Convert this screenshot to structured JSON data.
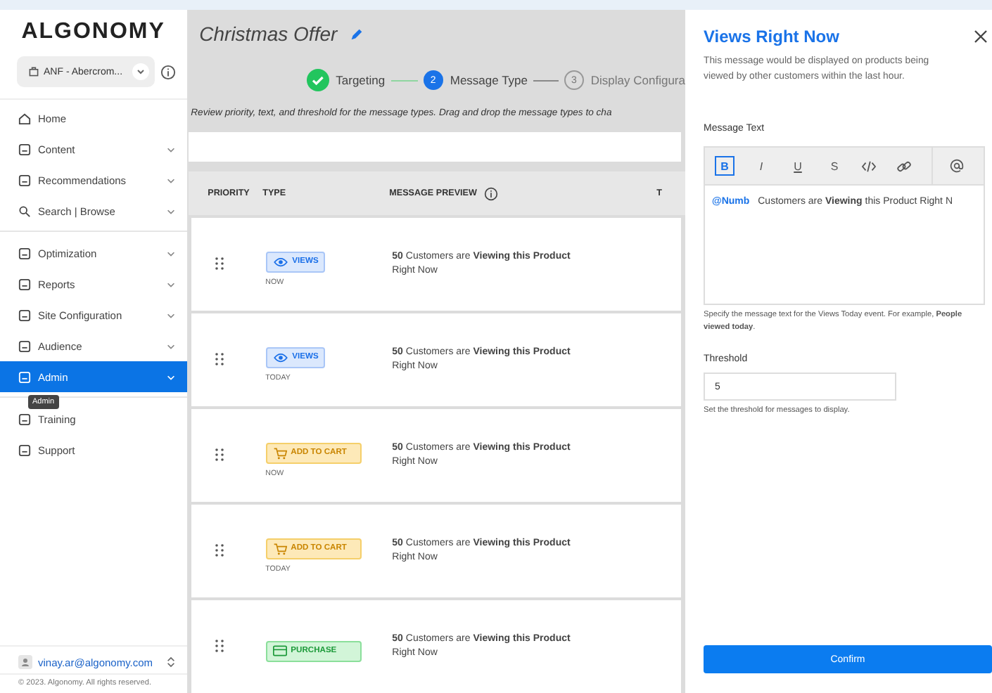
{
  "sidebar": {
    "logo": "ALGONOMY",
    "account_selector": "ANF - Abercrom...",
    "items": [
      {
        "label": "Home",
        "expandable": false,
        "selected": false
      },
      {
        "label": "Content",
        "expandable": true,
        "selected": false
      },
      {
        "label": "Recommendations",
        "expandable": true,
        "selected": false
      },
      {
        "label": "Search | Browse",
        "expandable": true,
        "selected": false
      },
      {
        "label": "Optimization",
        "expandable": true,
        "selected": false
      },
      {
        "label": "Reports",
        "expandable": true,
        "selected": false
      },
      {
        "label": "Site Configuration",
        "expandable": true,
        "selected": false
      },
      {
        "label": "Audience",
        "expandable": true,
        "selected": false
      },
      {
        "label": "Admin",
        "expandable": true,
        "selected": true
      },
      {
        "label": "Training",
        "expandable": false,
        "selected": false
      },
      {
        "label": "Support",
        "expandable": false,
        "selected": false
      }
    ],
    "tooltip": "Admin",
    "user": "vinay.ar@algonomy.com",
    "copyright": "© 2023. Algonomy. All rights reserved."
  },
  "main": {
    "title": "Christmas Offer",
    "steps": [
      {
        "label": "Targeting",
        "kind": "done"
      },
      {
        "number": "2",
        "label": "Message Type",
        "kind": "active"
      },
      {
        "number": "3",
        "label": "Display Configura",
        "kind": "pending"
      }
    ],
    "description": "Review priority, text, and threshold for the message types. Drag and drop the message types to cha",
    "table": {
      "columns": [
        "PRIORITY",
        "TYPE",
        "MESSAGE PREVIEW",
        "T"
      ],
      "rows": [
        {
          "badge": "VIEWS",
          "kind": "views",
          "period": "NOW",
          "preview": "**50** Customers are **Viewing this Product** Right Now"
        },
        {
          "badge": "VIEWS",
          "kind": "views",
          "period": "TODAY",
          "preview": "**50** Customers are **Viewing this Product** Right Now"
        },
        {
          "badge": "ADD TO CART",
          "kind": "cart",
          "period": "NOW",
          "preview": "**50** Customers are **Viewing this Product** Right Now"
        },
        {
          "badge": "ADD TO CART",
          "kind": "cart",
          "period": "TODAY",
          "preview": "**50** Customers are **Viewing this Product** Right Now"
        },
        {
          "badge": "PURCHASE",
          "kind": "purchase",
          "preview": "**50** Customers are **Viewing this Product** Right Now"
        }
      ]
    }
  },
  "panel": {
    "title": "Views Right Now",
    "description": "This message would be displayed on products being viewed by other customers within the last hour.",
    "message_label": "Message Text",
    "toolbar": [
      {
        "label": "B",
        "selected": true
      },
      {
        "label": "I",
        "selected": false
      },
      {
        "label": "U",
        "selected": false
      },
      {
        "label": "S",
        "selected": false
      }
    ],
    "mention": "@Numb",
    "message": "Customers are **Viewing** this Product Right N",
    "message_help": "Specify the message text for the Views Today event. For example, **People viewed today**.",
    "threshold_label": "Threshold",
    "threshold": "5",
    "threshold_help": "Set the threshold for messages to display.",
    "confirm": "Confirm"
  }
}
